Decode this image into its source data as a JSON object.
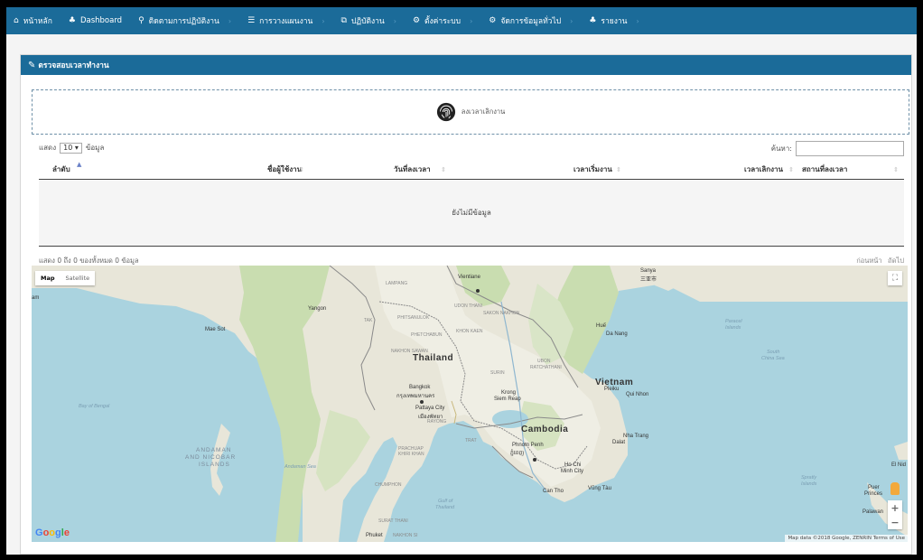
{
  "nav": {
    "items": [
      {
        "icon": "⌂",
        "label": "หน้าหลัก",
        "caret": ""
      },
      {
        "icon": "♣",
        "label": "Dashboard",
        "caret": ""
      },
      {
        "icon": "⚲",
        "label": "ติดตามการปฏิบัติงาน",
        "caret": "›"
      },
      {
        "icon": "☰",
        "label": "การวางแผนงาน",
        "caret": "›"
      },
      {
        "icon": "⧉",
        "label": "ปฏิบัติงาน",
        "caret": "›"
      },
      {
        "icon": "⚙",
        "label": "ตั้งค่าระบบ",
        "caret": "›"
      },
      {
        "icon": "⚙",
        "label": "จัดการข้อมูลทั่วไป",
        "caret": "›"
      },
      {
        "icon": "♣",
        "label": "รายงาน",
        "caret": "›"
      }
    ]
  },
  "panel": {
    "title": "ตรวจสอบเวลาทำงาน"
  },
  "clock": {
    "label": "ลงเวลาเลิกงาน"
  },
  "table": {
    "length_prefix": "แสดง",
    "length_value": "10",
    "length_suffix": "ข้อมูล",
    "search_label": "ค้นหา:",
    "columns": [
      "ลำดับ",
      "ชื่อผู้ใช้งาน",
      "วันที่ลงเวลา",
      "เวลาเริ่มงาน",
      "เวลาเลิกงาน",
      "สถานที่ลงเวลา"
    ],
    "empty_text": "ยังไม่มีข้อมูล",
    "info": "แสดง 0 ถึง 0 ของทั้งหมด 0 ข้อมูล",
    "pager_prev": "ก่อนหน้า",
    "pager_next": "ถัดไป"
  },
  "map": {
    "type_map": "Map",
    "type_satellite": "Satellite",
    "attribution": "Map data ©2018 Google, ZENRIN  Terms of Use",
    "logo": "Google",
    "labels": {
      "thailand": "Thailand",
      "vietnam": "Vietnam",
      "cambodia": "Cambodia",
      "vientiane": "Vientiane",
      "bangkok": "Bangkok",
      "bangkok_th": "กรุงเทพมหานคร",
      "pattaya": "Pattaya City",
      "pattaya_th": "เมืองพัทยา",
      "phnom_penh": "Phnom Penh",
      "phnom_penh_km": "ភ្នំពេញ",
      "ho_chi_minh": "Ho Chi",
      "ho_chi_minh_2": "Minh City",
      "yangon": "Yangon",
      "da_nang": "Da Nang",
      "hue": "Huế",
      "qui_nhon": "Qui Nhon",
      "pleiku": "Pleiku",
      "nha_trang": "Nha Trang",
      "dalat": "Dalat",
      "can_tho": "Can Tho",
      "vung_tau": "Vũng Tàu",
      "krong_siem_reap": "Krong",
      "siem_reap": "Siem Reap",
      "sanya": "Sanya",
      "sanya_cn": "三亚市",
      "bay_of_bengal": "Bay of Bengal",
      "andaman": "ANDAMAN",
      "andaman_2": "AND NICOBAR",
      "andaman_3": "ISLANDS",
      "andaman_sea": "Andaman Sea",
      "gulf_thailand": "Gulf of",
      "gulf_thailand_2": "Thailand",
      "south_china_sea": "South",
      "south_china_sea_2": "China Sea",
      "paracel": "Paracel",
      "paracel_2": "Islands",
      "spratly": "Spratly",
      "spratly_2": "Islands",
      "palawan": "Palawan",
      "puerto_princesa": "Puer",
      "puerto_princesa_2": "Princes",
      "el_nido": "El Nid",
      "udon_thani": "UDON THANI",
      "sakon_nakhon": "SAKON NAKHON",
      "khon_kaen": "KHON KAEN",
      "phetchabun": "PHETCHABUN",
      "phitsanulok": "PHITSANULOK",
      "nakhon_sawan": "NAKHON SAWAN",
      "ubon": "UBON",
      "ratchathani": "RATCHATHANI",
      "surin": "SURIN",
      "tak": "TAK",
      "lampang": "LAMPANG",
      "chumphon": "CHUMPHON",
      "surat_thani": "SURAT THANI",
      "prachuap": "PRACHUAP",
      "khiri_khan": "KHIRI KHAN",
      "rayong": "RAYONG",
      "trat": "TRAT",
      "phuket": "Phuket",
      "nakhon_si": "NAKHON SI",
      "mae_sot": "Mae Sot",
      "am": "am"
    }
  },
  "colors": {
    "nav_bg": "#1b6b99",
    "water": "#aad3df",
    "land": "#e8e6d9",
    "forest": "#c9ddb0"
  }
}
